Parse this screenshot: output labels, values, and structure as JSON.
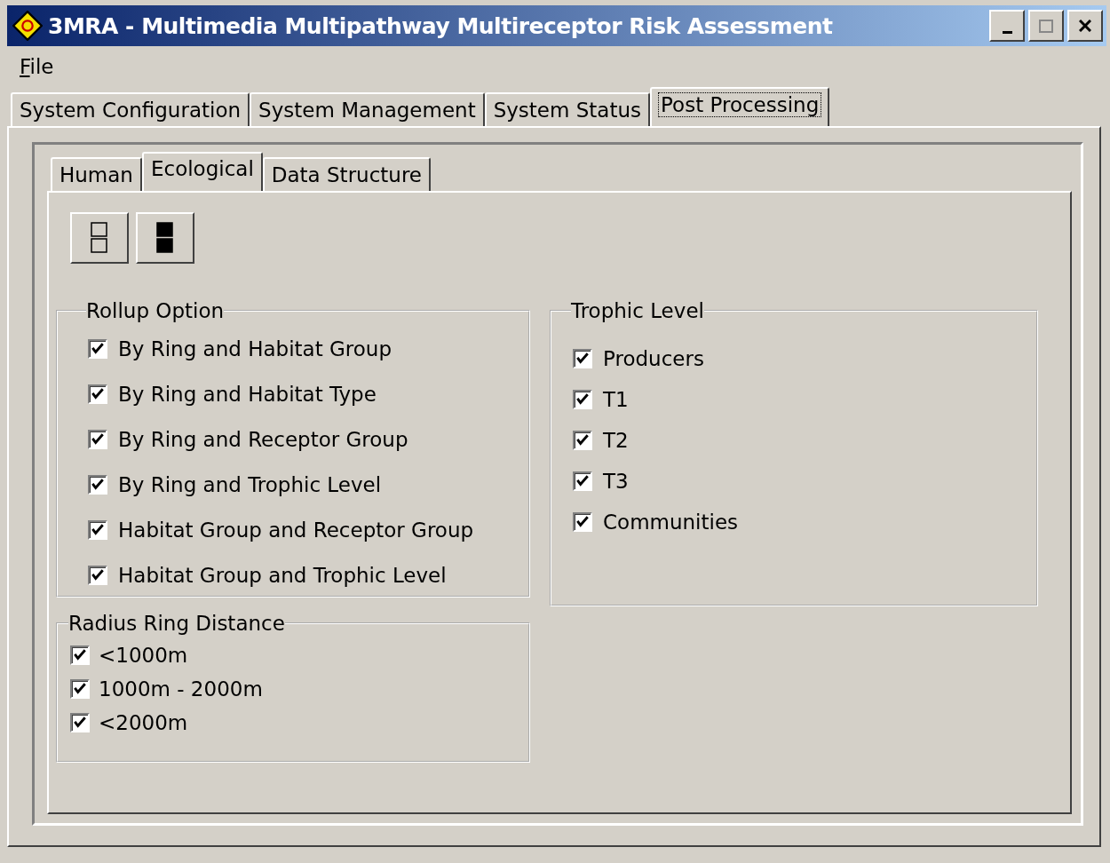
{
  "window": {
    "title": "3MRA - Multimedia Multipathway Multireceptor Risk Assessment"
  },
  "menu": [
    "File"
  ],
  "tabs": [
    {
      "label": "System Configuration",
      "selected": false
    },
    {
      "label": "System Management",
      "selected": false
    },
    {
      "label": "System Status",
      "selected": false
    },
    {
      "label": "Post Processing",
      "selected": true
    }
  ],
  "subtabs": [
    {
      "label": "Human",
      "selected": false
    },
    {
      "label": "Ecological",
      "selected": true
    },
    {
      "label": "Data Structure",
      "selected": false
    }
  ],
  "toolbar": [
    {
      "kind": "empty"
    },
    {
      "kind": "filled"
    }
  ],
  "rollup_option": {
    "title": "Rollup Option",
    "items": [
      {
        "label": "By Ring and Habitat Group",
        "checked": true
      },
      {
        "label": "By Ring and Habitat Type",
        "checked": true
      },
      {
        "label": "By Ring and Receptor Group",
        "checked": true
      },
      {
        "label": "By Ring and Trophic Level",
        "checked": true
      },
      {
        "label": "Habitat Group and Receptor Group",
        "checked": true
      },
      {
        "label": "Habitat Group and Trophic Level",
        "checked": true
      }
    ]
  },
  "trophic_level": {
    "title": "Trophic Level",
    "items": [
      {
        "label": "Producers",
        "checked": true
      },
      {
        "label": "T1",
        "checked": true
      },
      {
        "label": "T2",
        "checked": true
      },
      {
        "label": "T3",
        "checked": true
      },
      {
        "label": "Communities",
        "checked": true
      }
    ]
  },
  "radius_ring_distance": {
    "title": "Radius Ring Distance",
    "items": [
      {
        "label": "<1000m",
        "checked": true
      },
      {
        "label": "1000m - 2000m",
        "checked": true
      },
      {
        "label": "<2000m",
        "checked": true
      }
    ]
  }
}
